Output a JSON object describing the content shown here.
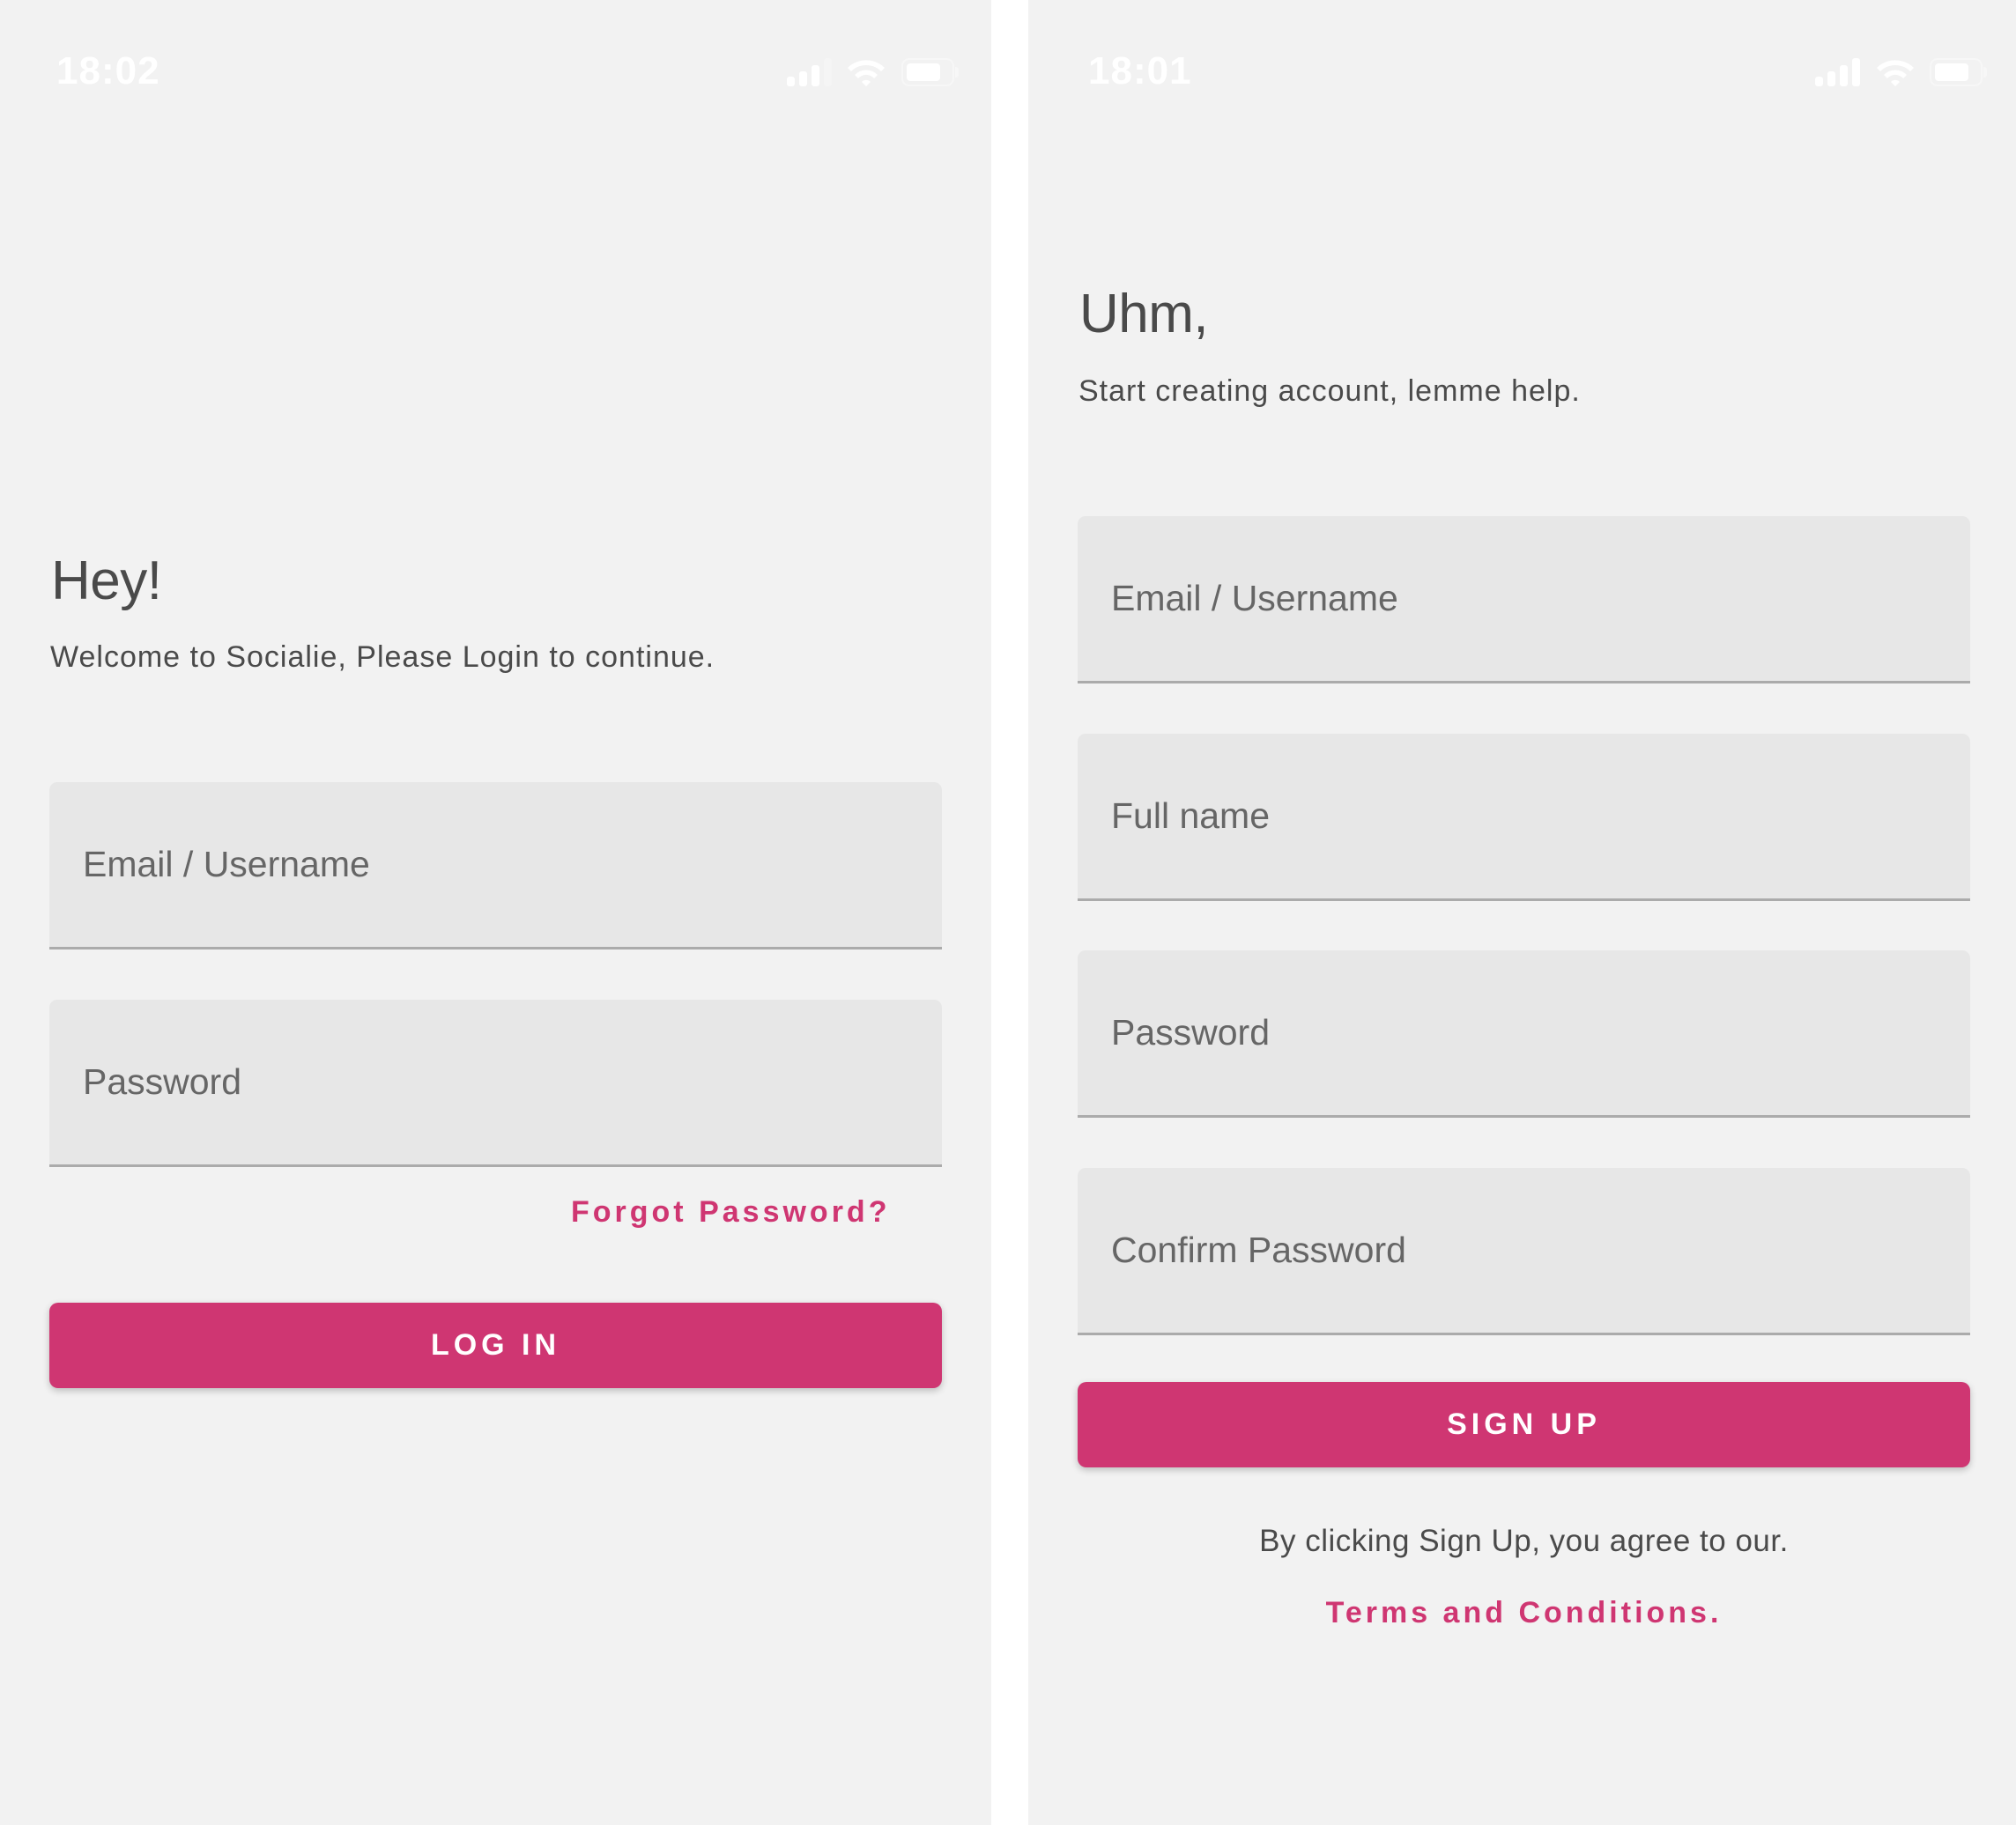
{
  "colors": {
    "background": "#F2F2F2",
    "field_background": "#E7E7E7",
    "field_underline": "#ABABAB",
    "accent": "#CF3672",
    "text_primary": "#4A4A4A",
    "text_placeholder": "#666666",
    "status_bar_text": "#FFFFFF"
  },
  "login_screen": {
    "status_bar": {
      "time": "18:02",
      "signal_bars_active": 3,
      "signal_bars_total": 4,
      "signal_icon": "cellular-signal-icon",
      "wifi_icon": "wifi-icon",
      "battery_icon": "battery-icon",
      "battery_level_percent": 80
    },
    "heading": "Hey!",
    "subtitle": "Welcome to Socialie, Please Login to continue.",
    "fields": [
      {
        "name": "email-username",
        "placeholder": "Email / Username",
        "value": "",
        "type": "text"
      },
      {
        "name": "password",
        "placeholder": "Password",
        "value": "",
        "type": "password"
      }
    ],
    "forgot_password_link": "Forgot Password?",
    "login_button": "LOG IN"
  },
  "signup_screen": {
    "status_bar": {
      "time": "18:01",
      "signal_bars_active": 4,
      "signal_bars_total": 4,
      "signal_icon": "cellular-signal-icon",
      "wifi_icon": "wifi-icon",
      "battery_icon": "battery-icon",
      "battery_level_percent": 80
    },
    "heading": "Uhm,",
    "subtitle": "Start creating account, lemme help.",
    "fields": [
      {
        "name": "email-username",
        "placeholder": "Email / Username",
        "value": "",
        "type": "text"
      },
      {
        "name": "full-name",
        "placeholder": "Full name",
        "value": "",
        "type": "text"
      },
      {
        "name": "password",
        "placeholder": "Password",
        "value": "",
        "type": "password"
      },
      {
        "name": "confirm-password",
        "placeholder": "Confirm Password",
        "value": "",
        "type": "password"
      }
    ],
    "signup_button": "SIGN UP",
    "agreement_text": "By clicking Sign Up, you agree to our.",
    "terms_link": "Terms and Conditions."
  }
}
